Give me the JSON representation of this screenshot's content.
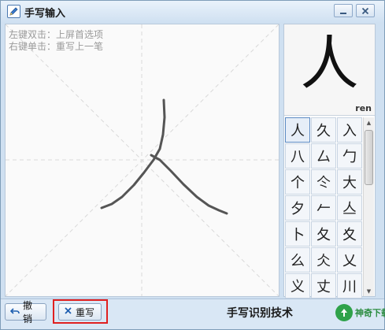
{
  "window": {
    "title": "手写输入",
    "minimize_glyph": "—",
    "close_glyph": "✕"
  },
  "canvas": {
    "hint_line1": "左键双击：上屏首选项",
    "hint_line2": "右键单击：重写上一笔"
  },
  "preview": {
    "character": "人",
    "pinyin": "ren"
  },
  "candidates": [
    "人",
    "久",
    "入",
    "八",
    "厶",
    "勹",
    "个",
    "仒",
    "大",
    "夕",
    "𠂉",
    "亼",
    "卜",
    "夂",
    "夊",
    "么",
    "仌",
    "乂",
    "义",
    "丈",
    "川"
  ],
  "selected_index": 0,
  "toolbar": {
    "undo_label": "撤销",
    "rewrite_label": "重写",
    "footer_title": "手写识别技术",
    "watermark_text": "神奇下载"
  },
  "icons": {
    "app": "pen-edit-icon",
    "undo": "undo-arrow-icon",
    "rewrite": "x-clear-icon",
    "watermark": "logo-icon"
  },
  "colors": {
    "highlight": "#e02020",
    "stroke": "#555555",
    "title_bar": "#cfe0f1"
  }
}
